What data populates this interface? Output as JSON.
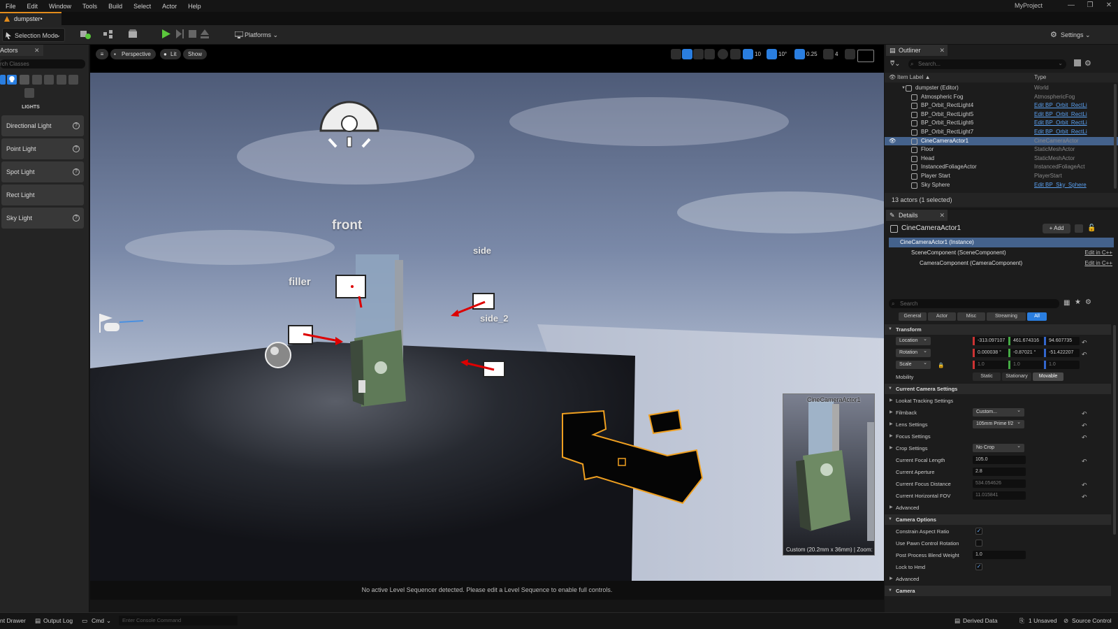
{
  "menu": [
    "File",
    "Edit",
    "Window",
    "Tools",
    "Build",
    "Select",
    "Actor",
    "Help"
  ],
  "project_name": "MyProject",
  "window_controls": [
    "—",
    "❐",
    "✕"
  ],
  "level_tab": "dumpster•",
  "toolbar": {
    "selection_mode": "Selection Mode",
    "platforms": "Platforms",
    "settings": "Settings"
  },
  "place_actors": {
    "tab": "Actors",
    "search_placeholder": "rch Classes",
    "category": "LIGHTS",
    "items": [
      "Directional Light",
      "Point Light",
      "Spot Light",
      "Rect Light",
      "Sky Light"
    ],
    "help_glyph": "?"
  },
  "viewport": {
    "perspective": "Perspective",
    "lit": "Lit",
    "show": "Show",
    "grid_snap": "10",
    "rot_snap": "10°",
    "scale_snap": "0.25",
    "cam_speed": "4",
    "labels": {
      "front": "front",
      "side": "side",
      "filler": "filler",
      "side_2": "side_2"
    },
    "preview_title": "CineCameraActor1",
    "preview_footer": "Custom (20.2mm x 36mm) | Zoom:",
    "status": "No active Level Sequencer detected. Please edit a Level Sequence to enable full controls."
  },
  "outliner": {
    "tab": "Outliner",
    "search_placeholder": "Search...",
    "col_label": "Item Label ▲",
    "col_type": "Type",
    "rows": [
      {
        "label": "dumpster (Editor)",
        "type": "World",
        "link": false,
        "indent": 0
      },
      {
        "label": "Atmospheric Fog",
        "type": "AtmosphericFog",
        "link": false,
        "indent": 1
      },
      {
        "label": "BP_Orbit_RectLight4",
        "type": "Edit BP_Orbit_RectLi",
        "link": true,
        "indent": 1
      },
      {
        "label": "BP_Orbit_RectLight5",
        "type": "Edit BP_Orbit_RectLi",
        "link": true,
        "indent": 1
      },
      {
        "label": "BP_Orbit_RectLight6",
        "type": "Edit BP_Orbit_RectLi",
        "link": true,
        "indent": 1
      },
      {
        "label": "BP_Orbit_RectLight7",
        "type": "Edit BP_Orbit_RectLi",
        "link": true,
        "indent": 1
      },
      {
        "label": "CineCameraActor1",
        "type": "CineCameraActor",
        "link": false,
        "indent": 1,
        "selected": true
      },
      {
        "label": "Floor",
        "type": "StaticMeshActor",
        "link": false,
        "indent": 1
      },
      {
        "label": "Head",
        "type": "StaticMeshActor",
        "link": false,
        "indent": 1
      },
      {
        "label": "InstancedFoliageActor",
        "type": "InstancedFoliageAct",
        "link": false,
        "indent": 1
      },
      {
        "label": "Player Start",
        "type": "PlayerStart",
        "link": false,
        "indent": 1
      },
      {
        "label": "Sky Sphere",
        "type": "Edit BP_Sky_Sphere",
        "link": true,
        "indent": 1
      }
    ],
    "footer": "13 actors (1 selected)"
  },
  "details": {
    "tab": "Details",
    "actor_name": "CineCameraActor1",
    "add": "+ Add",
    "components": [
      {
        "label": "CineCameraActor1 (Instance)",
        "edit": ""
      },
      {
        "label": "SceneComponent (SceneComponent)",
        "edit": "Edit in C++"
      },
      {
        "label": "CameraComponent (CameraComponent)",
        "edit": "Edit in C++"
      }
    ],
    "search_placeholder": "Search",
    "filters": [
      "General",
      "Actor",
      "Misc",
      "Streaming",
      "All"
    ],
    "transform": {
      "heading": "Transform",
      "location_label": "Location",
      "location": [
        "-313.097107",
        "461.674316",
        "94.607735"
      ],
      "rotation_label": "Rotation",
      "rotation": [
        "0.000038 °",
        "-0.87021 °",
        "-51.422207"
      ],
      "scale_label": "Scale",
      "scale": [
        "1.0",
        "1.0",
        "1.0"
      ],
      "mobility_label": "Mobility",
      "mobility": [
        "Static",
        "Stationary",
        "Movable"
      ]
    },
    "camera_settings": {
      "heading": "Current Camera Settings",
      "lookat": "Lookat Tracking Settings",
      "filmback": "Filmback",
      "filmback_value": "Custom...",
      "lens": "Lens Settings",
      "lens_value": "105mm Prime f/2",
      "focus": "Focus Settings",
      "crop": "Crop Settings",
      "crop_value": "No Crop",
      "focal_length": "Current Focal Length",
      "focal_length_value": "105.0",
      "aperture": "Current Aperture",
      "aperture_value": "2.8",
      "focus_distance": "Current Focus Distance",
      "focus_distance_value": "534.054626",
      "hfov": "Current Horizontal FOV",
      "hfov_value": "11.015841",
      "advanced": "Advanced"
    },
    "camera_options": {
      "heading": "Camera Options",
      "constrain": "Constrain Aspect Ratio",
      "pawn_rotation": "Use Pawn Control Rotation",
      "pp_blend": "Post Process Blend Weight",
      "pp_blend_value": "1.0",
      "lock_hmd": "Lock to Hmd",
      "advanced": "Advanced",
      "check": "✓"
    },
    "camera_heading": "Camera",
    "reset_glyph": "↶"
  },
  "statusbar": {
    "content_drawer": "nt Drawer",
    "output_log": "Output Log",
    "cmd": "Cmd",
    "console_placeholder": "Enter Console Command",
    "derived_data": "Derived Data",
    "unsaved": "1 Unsaved",
    "source_control": "Source Control"
  },
  "colors": {
    "accent": "#2a7ee0",
    "selection": "#44628c",
    "level_tab_accent": "#e38c1b",
    "play_green": "#5bc83c",
    "camera_outline": "#f0a020"
  }
}
